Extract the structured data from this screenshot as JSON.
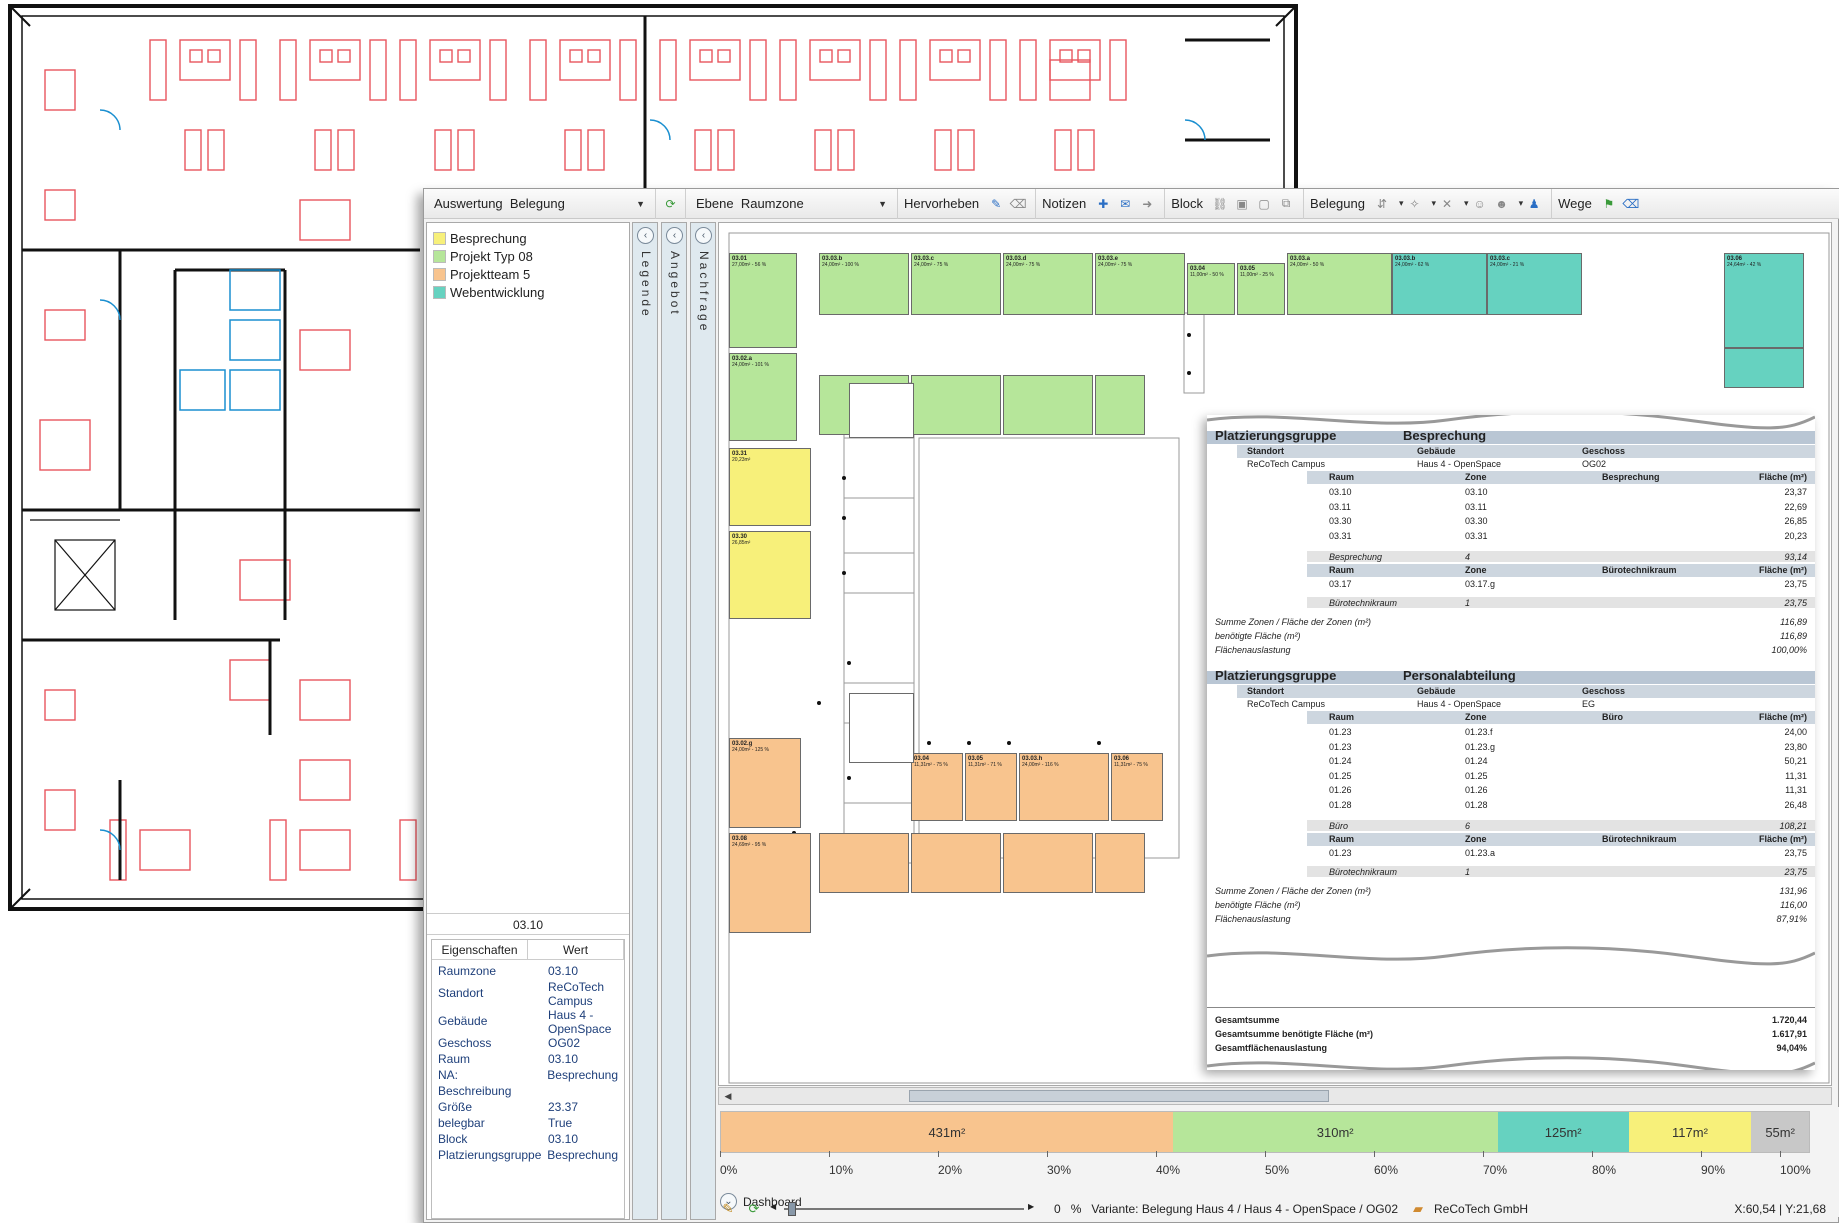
{
  "toolbar": {
    "auswertung_label": "Auswertung",
    "auswertung_value": "Belegung",
    "ebene_label": "Ebene",
    "ebene_value": "Raumzone",
    "hervorheben_label": "Hervorheben",
    "notizen_label": "Notizen",
    "block_label": "Block",
    "belegung_label": "Belegung",
    "wege_label": "Wege"
  },
  "legend": {
    "items": [
      {
        "label": "Besprechung",
        "color": "#f7f07a"
      },
      {
        "label": "Projekt Typ 08",
        "color": "#b6e69a"
      },
      {
        "label": "Projektteam 5",
        "color": "#f8c48e"
      },
      {
        "label": "Webentwicklung",
        "color": "#66d2c0"
      }
    ]
  },
  "tabs": {
    "legende": "Legende",
    "angebot": "Angebot",
    "nachfrage": "Nachfrage"
  },
  "properties": {
    "selected": "03.10",
    "head_key": "Eigenschaften",
    "head_value": "Wert",
    "rows": [
      {
        "k": "Raumzone",
        "v": "03.10"
      },
      {
        "k": "Standort",
        "v": "ReCoTech Campus"
      },
      {
        "k": "Gebäude",
        "v": "Haus 4 - OpenSpace"
      },
      {
        "k": "Geschoss",
        "v": "OG02"
      },
      {
        "k": "Raum",
        "v": "03.10"
      },
      {
        "k": "NA:",
        "v": "Besprechung"
      },
      {
        "k": "Beschreibung",
        "v": ""
      },
      {
        "k": "Größe",
        "v": "23.37"
      },
      {
        "k": "belegbar",
        "v": "True"
      },
      {
        "k": "Block",
        "v": "03.10"
      },
      {
        "k": "Platzierungsgruppe",
        "v": "Besprechung"
      }
    ]
  },
  "plan_rooms": [
    {
      "id": "03.01",
      "t": "27,00m² - 56 %",
      "color": "#b6e69a"
    },
    {
      "id": "03.03.b",
      "t": "24,00m² - 100 %",
      "color": "#b6e69a"
    },
    {
      "id": "03.03.c",
      "t": "24,00m² - 75 %",
      "color": "#b6e69a"
    },
    {
      "id": "03.03.d",
      "t": "24,00m² - 75 %",
      "color": "#b6e69a"
    },
    {
      "id": "03.03.e",
      "t": "24,00m² - 75 %",
      "color": "#b6e69a"
    },
    {
      "id": "03.04",
      "t": "11,00m² - 50 %",
      "color": "#b6e69a"
    },
    {
      "id": "03.05",
      "t": "11,00m² - 25 %",
      "color": "#b6e69a"
    },
    {
      "id": "03.03.a",
      "t": "24,00m² - 50 %",
      "color": "#b6e69a"
    },
    {
      "id": "03.03.b2",
      "t": "24,00m² - 62 %",
      "color": "#66d2c0"
    },
    {
      "id": "03.03.c2",
      "t": "24,00m² - 21 %",
      "color": "#66d2c0"
    },
    {
      "id": "03.06",
      "t": "24,64m² - 42 %",
      "color": "#66d2c0"
    },
    {
      "id": "03.02.a",
      "t": "24,00m² - 101 %",
      "color": "#b6e69a"
    },
    {
      "id": "03.31",
      "t": "20,23m²",
      "color": "#f7f07a"
    },
    {
      "id": "03.30",
      "t": "26,85m²",
      "color": "#f7f07a"
    },
    {
      "id": "03.02.g",
      "t": "24,00m² - 125 %",
      "color": "#f8c48e"
    },
    {
      "id": "03.04b",
      "t": "11,31m² - 75 %",
      "color": "#f8c48e"
    },
    {
      "id": "03.05b",
      "t": "11,31m² - 71 %",
      "color": "#f8c48e"
    },
    {
      "id": "03.03.h",
      "t": "24,00m² - 116 %",
      "color": "#f8c48e"
    },
    {
      "id": "03.06b",
      "t": "11,31m² - 75 %",
      "color": "#f8c48e"
    },
    {
      "id": "03.08",
      "t": "24,69m² - 95 %",
      "color": "#f8c48e"
    }
  ],
  "report": {
    "g1_label": "Platzierungsgruppe",
    "g1_name": "Besprechung",
    "g2_name": "Personalabteilung",
    "h_standort": "Standort",
    "h_gebaeude": "Gebäude",
    "h_geschoss": "Geschoss",
    "campus": "ReCoTech Campus",
    "building": "Haus 4 - OpenSpace",
    "floor1": "OG02",
    "floor2": "EG",
    "h_raum": "Raum",
    "h_zone": "Zone",
    "h_flaeche": "Fläche (m²)",
    "h_besprechung": "Besprechung",
    "h_buero_technik": "Bürotechnikraum",
    "h_buero": "Büro",
    "g1_rows": [
      {
        "r": "03.10",
        "z": "03.10",
        "f": "23,37"
      },
      {
        "r": "03.11",
        "z": "03.11",
        "f": "22,69"
      },
      {
        "r": "03.30",
        "z": "03.30",
        "f": "26,85"
      },
      {
        "r": "03.31",
        "z": "03.31",
        "f": "20,23"
      }
    ],
    "g1_sub": {
      "label": "Besprechung",
      "count": "4",
      "sum": "93,14"
    },
    "g1_tech": {
      "r": "03.17",
      "z": "03.17.g",
      "f": "23,75"
    },
    "g1_tech_sub": {
      "label": "Bürotechnikraum",
      "count": "1",
      "sum": "23,75"
    },
    "g1_sum": {
      "label": "Summe Zonen / Fläche der Zonen (m²)",
      "v": "116,89"
    },
    "g1_need": {
      "label": "benötigte Fläche (m²)",
      "v": "116,89"
    },
    "g1_load": {
      "label": "Flächenauslastung",
      "v": "100,00%"
    },
    "g2_rows": [
      {
        "r": "01.23",
        "z": "01.23.f",
        "f": "24,00"
      },
      {
        "r": "01.23",
        "z": "01.23.g",
        "f": "23,80"
      },
      {
        "r": "01.24",
        "z": "01.24",
        "f": "50,21"
      },
      {
        "r": "01.25",
        "z": "01.25",
        "f": "11,31"
      },
      {
        "r": "01.26",
        "z": "01.26",
        "f": "11,31"
      },
      {
        "r": "01.28",
        "z": "01.28",
        "f": "26,48"
      }
    ],
    "g2_sub": {
      "label": "Büro",
      "count": "6",
      "sum": "108,21"
    },
    "g2_tech": {
      "r": "01.23",
      "z": "01.23.a",
      "f": "23,75"
    },
    "g2_tech_sub": {
      "label": "Bürotechnikraum",
      "count": "1",
      "sum": "23,75"
    },
    "g2_sum": {
      "label": "Summe Zonen / Fläche der Zonen (m²)",
      "v": "131,96"
    },
    "g2_need": {
      "label": "benötigte Fläche (m²)",
      "v": "116,00"
    },
    "g2_load": {
      "label": "Flächenauslastung",
      "v": "87,91%"
    },
    "total": {
      "label": "Gesamtsumme",
      "v": "1.720,44"
    },
    "total_need": {
      "label": "Gesamtsumme benötigte Fläche (m²)",
      "v": "1.617,91"
    },
    "total_load": {
      "label": "Gesamtflächenauslastung",
      "v": "94,04%"
    }
  },
  "dashboard": {
    "label": "Dashboard",
    "segments": [
      {
        "label": "431m²",
        "value": 431,
        "color": "#f8c48e"
      },
      {
        "label": "310m²",
        "value": 310,
        "color": "#b6e69a"
      },
      {
        "label": "125m²",
        "value": 125,
        "color": "#66d2c0"
      },
      {
        "label": "117m²",
        "value": 117,
        "color": "#f7f07a"
      },
      {
        "label": "55m²",
        "value": 55,
        "color": "#c8c8c8"
      }
    ],
    "ticks": [
      "0%",
      "10%",
      "20%",
      "30%",
      "40%",
      "50%",
      "60%",
      "70%",
      "80%",
      "90%",
      "100%"
    ]
  },
  "status": {
    "zoom_value": "0",
    "zoom_unit": "%",
    "variant": "Variante: Belegung Haus 4 / Haus 4 - OpenSpace / OG02",
    "company": "ReCoTech GmbH",
    "coords": "X:60,54 | Y:21,68"
  }
}
